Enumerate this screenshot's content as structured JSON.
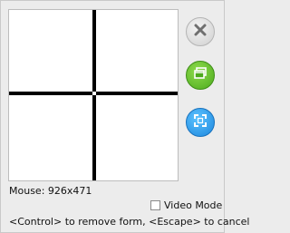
{
  "status": {
    "mouse_label": "Mouse:",
    "mouse_value": "926x471"
  },
  "video_mode": {
    "label": "Video Mode",
    "checked": false
  },
  "hint": "<Control> to remove form, <Escape> to cancel",
  "buttons": {
    "close": {
      "icon": "close-icon",
      "color": "#cfcfcf"
    },
    "window": {
      "icon": "window-icon",
      "color": "#4caa1d"
    },
    "fullscreen": {
      "icon": "fullscreen-icon",
      "color": "#1b86dd"
    }
  }
}
